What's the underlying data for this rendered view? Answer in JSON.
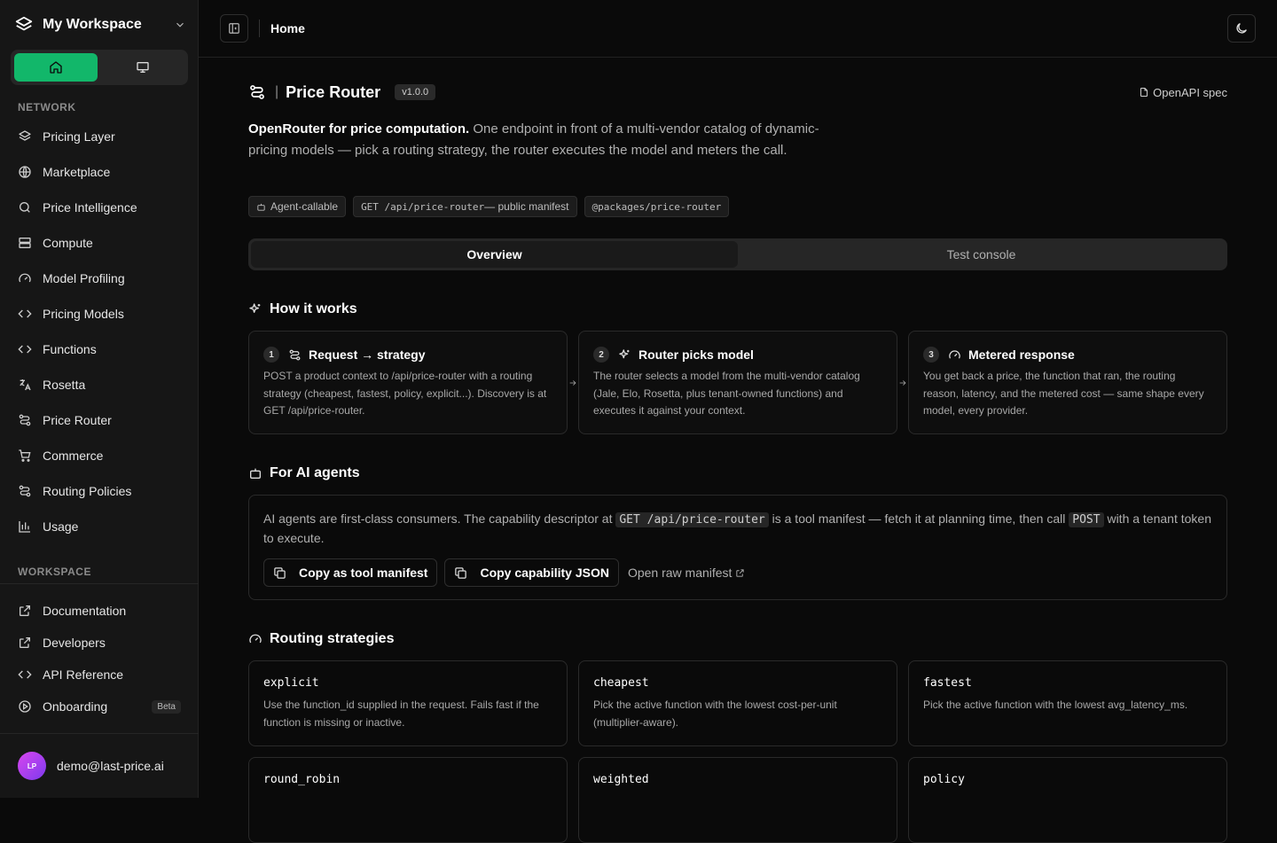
{
  "workspace": {
    "title": "My Workspace"
  },
  "sidebar": {
    "network_label": "NETWORK",
    "network_items": [
      {
        "label": "Pricing Layer",
        "icon": "layers-icon"
      },
      {
        "label": "Marketplace",
        "icon": "globe-icon"
      },
      {
        "label": "Price Intelligence",
        "icon": "search-icon"
      },
      {
        "label": "Compute",
        "icon": "server-icon"
      },
      {
        "label": "Model Profiling",
        "icon": "gauge-icon"
      },
      {
        "label": "Pricing Models",
        "icon": "code-icon"
      },
      {
        "label": "Functions",
        "icon": "code-icon"
      },
      {
        "label": "Rosetta",
        "icon": "translate-icon"
      },
      {
        "label": "Price Router",
        "icon": "route-icon"
      },
      {
        "label": "Commerce",
        "icon": "cart-icon"
      },
      {
        "label": "Routing Policies",
        "icon": "route-icon"
      },
      {
        "label": "Usage",
        "icon": "bar-chart-icon"
      }
    ],
    "workspace_label": "WORKSPACE",
    "workspace_items": [
      {
        "label": "Documentation",
        "icon": "external-link-icon"
      },
      {
        "label": "Developers",
        "icon": "external-link-icon"
      },
      {
        "label": "API Reference",
        "icon": "code-icon"
      },
      {
        "label": "Onboarding",
        "icon": "play-circle-icon",
        "badge": "Beta"
      }
    ],
    "user": {
      "initials": "LP",
      "email": "demo@last-price.ai"
    }
  },
  "topbar": {
    "breadcrumb": "Home"
  },
  "page": {
    "title": "Price Router",
    "version": "v1.0.0",
    "openapi_label": "OpenAPI spec",
    "desc_bold": "OpenRouter for price computation.",
    "desc_rest": " One endpoint in front of a multi-vendor catalog of dynamic-pricing models — pick a routing strategy, the router executes the model and meters the call.",
    "tags": {
      "agent": "Agent-callable",
      "manifest_code": "GET /api/price-router",
      "manifest_suffix": " — public manifest",
      "package": "@packages/price-router"
    },
    "tabs": [
      "Overview",
      "Test console"
    ],
    "how_title": "How it works",
    "steps": [
      {
        "num": "1",
        "title": "Request → strategy",
        "text": "POST a product context to /api/price-router with a routing strategy (cheapest, fastest, policy, explicit...). Discovery is at GET /api/price-router."
      },
      {
        "num": "2",
        "title": "Router picks model",
        "text": "The router selects a model from the multi-vendor catalog (Jale, Elo, Rosetta, plus tenant-owned functions) and executes it against your context."
      },
      {
        "num": "3",
        "title": "Metered response",
        "text": "You get back a price, the function that ran, the routing reason, latency, and the metered cost — same shape every model, every provider."
      }
    ],
    "agents_title": "For AI agents",
    "agents": {
      "t1": "AI agents are first-class consumers. The capability descriptor at ",
      "code1": "GET /api/price-router",
      "t2": " is a tool manifest — fetch it at planning time, then call ",
      "code2": "POST",
      "t3": " with a tenant token to execute.",
      "btn_manifest": "Copy as tool manifest",
      "btn_json": "Copy capability JSON",
      "link_raw": "Open raw manifest"
    },
    "strategies_title": "Routing strategies",
    "strategies": [
      {
        "name": "explicit",
        "desc": "Use the function_id supplied in the request. Fails fast if the function is missing or inactive."
      },
      {
        "name": "cheapest",
        "desc": "Pick the active function with the lowest cost-per-unit (multiplier-aware)."
      },
      {
        "name": "fastest",
        "desc": "Pick the active function with the lowest avg_latency_ms."
      },
      {
        "name": "round_robin",
        "desc": ""
      },
      {
        "name": "weighted",
        "desc": ""
      },
      {
        "name": "policy",
        "desc": ""
      }
    ]
  },
  "colors": {
    "accent": "#12b76a",
    "background": "#0a0a0a",
    "sidebar": "#161616"
  }
}
